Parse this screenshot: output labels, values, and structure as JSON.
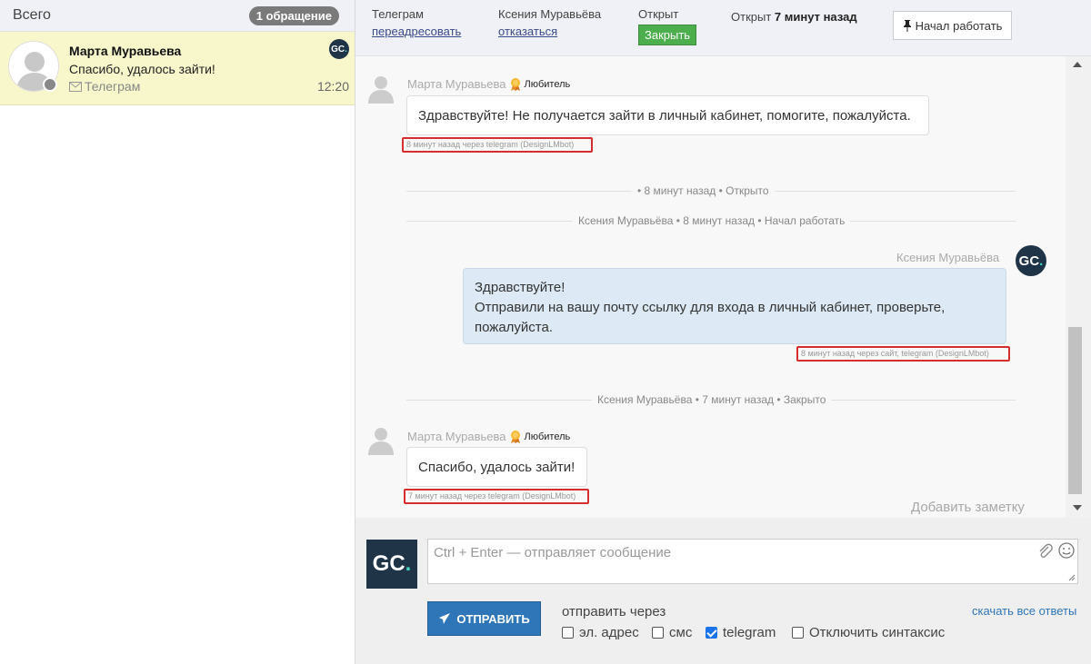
{
  "left": {
    "title": "Всего",
    "badge": "1 обращение",
    "conversation": {
      "name": "Марта Муравьева",
      "last_message": "Спасибо, удалось зайти!",
      "channel": "Телеграм",
      "time": "12:20",
      "logo": "GC."
    }
  },
  "topbar": {
    "channel_label": "Телеграм",
    "forward_link": "переадресовать",
    "agent_name": "Ксения Муравьёва",
    "refuse_link": "отказаться",
    "status_label": "Открыт",
    "close_button": "Закрыть",
    "opened_prefix": "Открыт",
    "opened_time": "7 минут назад",
    "start_button": "Начал работать"
  },
  "chat": {
    "messages": [
      {
        "author": "Марта Муравьева",
        "rank": "Любитель",
        "text": "Здравствуйте! Не получается зайти в личный кабинет, помогите, пожалуйста.",
        "meta": "8 минут назад через telegram (DesignLMbot)"
      },
      {
        "author": "Ксения Муравьёва",
        "text_line1": "Здравствуйте!",
        "text_line2": "Отправили на вашу почту ссылку для входа в личный кабинет, проверьте, пожалуйста.",
        "meta": "8 минут назад через сайт, telegram (DesignLMbot)"
      },
      {
        "author": "Марта Муравьева",
        "rank": "Любитель",
        "text": "Спасибо, удалось зайти!",
        "meta": "7 минут назад через telegram (DesignLMbot)"
      }
    ],
    "system": [
      "• 8 минут назад • Открыто",
      "Ксения Муравьёва • 8 минут назад • Начал работать",
      "Ксения Муравьёва • 7 минут назад • Закрыто"
    ],
    "add_note": "Добавить заметку"
  },
  "composer": {
    "logo": "GC.",
    "placeholder": "Ctrl + Enter — отправляет сообщение",
    "send_button": "ОТПРАВИТЬ",
    "send_via_label": "отправить через",
    "options": [
      {
        "label": "эл. адрес",
        "checked": false
      },
      {
        "label": "смс",
        "checked": false
      },
      {
        "label": "telegram",
        "checked": true
      },
      {
        "label": "Отключить синтаксис",
        "checked": false
      }
    ],
    "download_link": "скачать все ответы"
  },
  "colors": {
    "accent": "#2e76b8",
    "close_green": "#4cae4c",
    "highlight_row": "#f8f7cc",
    "outgoing_bubble": "#dde9f4",
    "meta_border": "#d62e2e"
  },
  "icons": [
    "user-silhouette-icon",
    "status-dot-icon",
    "envelope-icon",
    "pin-icon",
    "medal-icon",
    "paperclip-icon",
    "smile-icon",
    "paper-plane-icon",
    "resize-icon",
    "scroll-up-icon",
    "scroll-down-icon"
  ]
}
